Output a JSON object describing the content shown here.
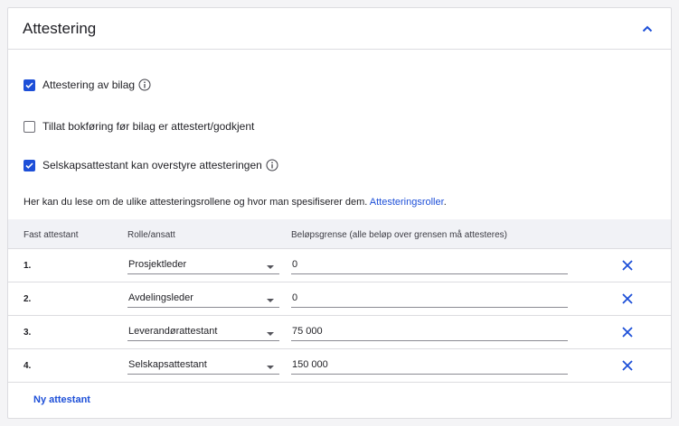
{
  "section": {
    "title": "Attestering"
  },
  "options": [
    {
      "label": "Attestering av bilag",
      "checked": true,
      "has_info": true
    },
    {
      "label": "Tillat bokføring før bilag er attestert/godkjent",
      "checked": false,
      "has_info": false
    },
    {
      "label": "Selskapsattestant kan overstyre attesteringen",
      "checked": true,
      "has_info": true
    }
  ],
  "note": {
    "text": "Her kan du lese om de ulike attesteringsrollene og hvor man spesifiserer dem. ",
    "link": "Attesteringsroller",
    "trailing": "."
  },
  "table": {
    "headers": [
      "Fast attestant",
      "Rolle/ansatt",
      "Beløpsgrense (alle beløp over grensen må attesteres)"
    ],
    "rows": [
      {
        "num": "1.",
        "role": "Prosjektleder",
        "amount": "0"
      },
      {
        "num": "2.",
        "role": "Avdelingsleder",
        "amount": "0"
      },
      {
        "num": "3.",
        "role": "Leverandørattestant",
        "amount": "75 000"
      },
      {
        "num": "4.",
        "role": "Selskapsattestant",
        "amount": "150 000"
      }
    ]
  },
  "add_button": {
    "label": "Ny attestant"
  },
  "colors": {
    "accent": "#1d4fd8",
    "header_bg": "#f1f2f6",
    "border": "#dcdce0"
  }
}
